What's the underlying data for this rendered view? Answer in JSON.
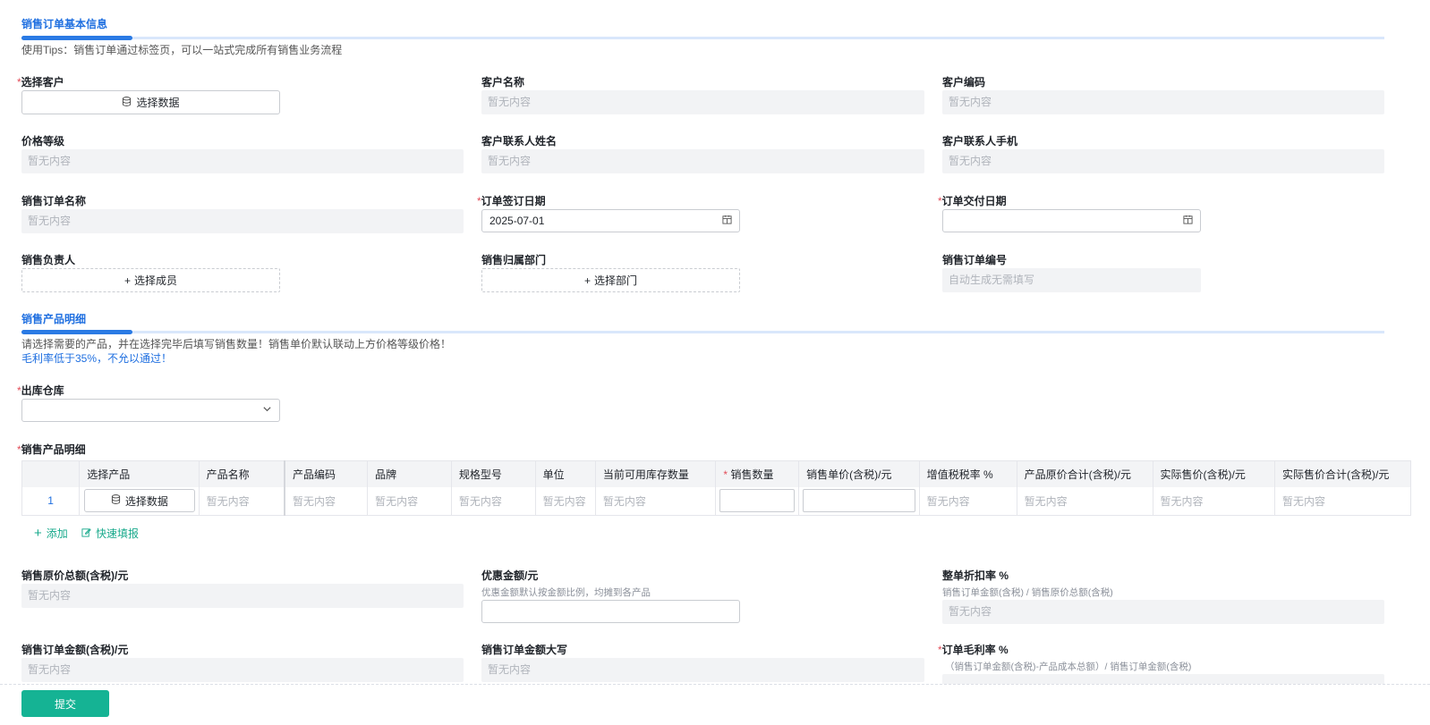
{
  "section1": {
    "title": "销售订单基本信息",
    "tips": "使用Tips：销售订单通过标签页，可以一站式完成所有销售业务流程"
  },
  "fields": {
    "customer_select": {
      "label": "选择客户",
      "button": "选择数据"
    },
    "customer_name": {
      "label": "客户名称",
      "value": "暂无内容"
    },
    "customer_code": {
      "label": "客户编码",
      "value": "暂无内容"
    },
    "price_level": {
      "label": "价格等级",
      "value": "暂无内容"
    },
    "contact_name": {
      "label": "客户联系人姓名",
      "value": "暂无内容"
    },
    "contact_phone": {
      "label": "客户联系人手机",
      "value": "暂无内容"
    },
    "order_name": {
      "label": "销售订单名称",
      "value": "暂无内容"
    },
    "sign_date": {
      "label": "订单签订日期",
      "value": "2025-07-01"
    },
    "delivery_date": {
      "label": "订单交付日期",
      "value": ""
    },
    "sales_owner": {
      "label": "销售负责人",
      "button": "选择成员"
    },
    "sales_dept": {
      "label": "销售归属部门",
      "button": "选择部门"
    },
    "order_no": {
      "label": "销售订单编号",
      "value": "自动生成无需填写"
    }
  },
  "section2": {
    "title": "销售产品明细",
    "tips": "请选择需要的产品，并在选择完毕后填写销售数量！销售单价默认联动上方价格等级价格！",
    "warning": "毛利率低于35%，不允以通过！"
  },
  "warehouse": {
    "label": "出库仓库",
    "value": ""
  },
  "product_table": {
    "label": "销售产品明细",
    "columns": [
      "选择产品",
      "产品名称",
      "产品编码",
      "品牌",
      "规格型号",
      "单位",
      "当前可用库存数量",
      "销售数量",
      "销售单价(含税)/元",
      "增值税税率 %",
      "产品原价合计(含税)/元",
      "实际售价(含税)/元",
      "实际售价合计(含税)/元"
    ],
    "rows": [
      {
        "index": "1",
        "select_btn": "选择数据",
        "cells": [
          "暂无内容",
          "暂无内容",
          "暂无内容",
          "暂无内容",
          "暂无内容",
          "暂无内容",
          "暂无内容",
          "暂无内容",
          "暂无内容",
          "暂无内容"
        ]
      }
    ],
    "add_label": "添加",
    "quick_fill_label": "快速填报"
  },
  "summary": {
    "original_total": {
      "label": "销售原价总额(含税)/元",
      "value": "暂无内容"
    },
    "discount_amount": {
      "label": "优惠金额/元",
      "hint": "优惠金额默认按金额比例，均摊到各产品",
      "value": ""
    },
    "discount_rate": {
      "label": "整单折扣率 %",
      "hint": "销售订单金额(含税) / 销售原价总额(含税)",
      "value": "暂无内容"
    },
    "order_amount": {
      "label": "销售订单金额(含税)/元",
      "value": "暂无内容"
    },
    "amount_uppercase": {
      "label": "销售订单金额大写",
      "value": "暂无内容"
    },
    "gross_margin": {
      "label": "订单毛利率 %",
      "hint": "（销售订单金额(含税)-产品成本总额）/ 销售订单金额(含税)"
    }
  },
  "required_mark": "*",
  "submit_label": "提交",
  "colors": {
    "accent": "#1f6fe0",
    "submit": "#15b394",
    "required": "#e34d59"
  }
}
